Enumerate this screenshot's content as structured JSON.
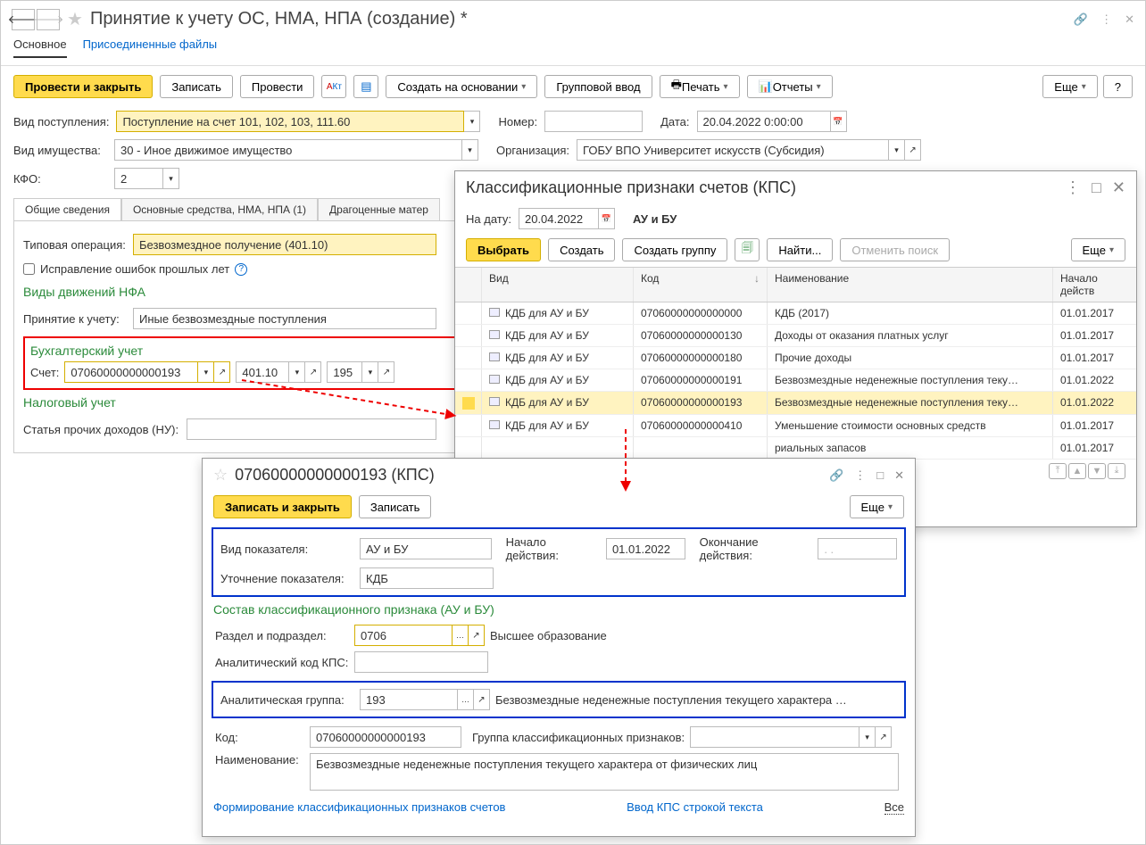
{
  "title": "Принятие к учету ОС, НМА, НПА (создание) *",
  "nav_tabs": {
    "main": "Основное",
    "attached": "Присоединенные файлы"
  },
  "toolbar": {
    "post_close": "Провести и закрыть",
    "save": "Записать",
    "post": "Провести",
    "create_based": "Создать на основании",
    "group_input": "Групповой ввод",
    "print": "Печать",
    "reports": "Отчеты",
    "more": "Еще",
    "help": "?"
  },
  "fields": {
    "type_receipt_label": "Вид поступления:",
    "type_receipt": "Поступление на счет 101, 102, 103, 111.60",
    "number_label": "Номер:",
    "date_label": "Дата:",
    "date": "20.04.2022  0:00:00",
    "property_label": "Вид имущества:",
    "property": "30 - Иное движимое имущество",
    "org_label": "Организация:",
    "org": "ГОБУ ВПО Университет искусств (Субсидия)",
    "kfo_label": "КФО:",
    "kfo": "2"
  },
  "inner_tabs": {
    "general": "Общие сведения",
    "os": "Основные средства, НМА, НПА (1)",
    "metals": "Драгоценные матер"
  },
  "general": {
    "typical_op_label": "Типовая операция:",
    "typical_op": "Безвозмездное получение (401.10)",
    "fix_errors": "Исправление ошибок прошлых лет",
    "section_moves": "Виды движений НФА",
    "acceptance_label": "Принятие к учету:",
    "acceptance": "Иные безвозмездные поступления",
    "section_acc": "Бухгалтерский учет",
    "account_label": "Счет:",
    "account_kps": "07060000000000193",
    "account_sub": "401.10",
    "account_kek": "195",
    "section_tax": "Налоговый учет",
    "tax_income_label": "Статья прочих доходов (НУ):"
  },
  "kps_popup": {
    "title": "Классификационные признаки счетов (КПС)",
    "date_label": "На дату:",
    "date": "20.04.2022",
    "mode": "АУ и БУ",
    "select": "Выбрать",
    "create": "Создать",
    "create_group": "Создать группу",
    "find": "Найти...",
    "cancel_search": "Отменить поиск",
    "more": "Еще",
    "col_type": "Вид",
    "col_code": "Код",
    "col_name": "Наименование",
    "col_start": "Начало действ",
    "rows": [
      {
        "type": "КДБ для АУ и БУ",
        "code": "07060000000000000",
        "name": "КДБ (2017)",
        "date": "01.01.2017"
      },
      {
        "type": "КДБ для АУ и БУ",
        "code": "07060000000000130",
        "name": "Доходы от оказания платных услуг",
        "date": "01.01.2017"
      },
      {
        "type": "КДБ для АУ и БУ",
        "code": "07060000000000180",
        "name": "Прочие доходы",
        "date": "01.01.2017"
      },
      {
        "type": "КДБ для АУ и БУ",
        "code": "07060000000000191",
        "name": "Безвозмездные неденежные поступления теку…",
        "date": "01.01.2022"
      },
      {
        "type": "КДБ для АУ и БУ",
        "code": "07060000000000193",
        "name": "Безвозмездные неденежные поступления теку…",
        "date": "01.01.2022"
      },
      {
        "type": "КДБ для АУ и БУ",
        "code": "07060000000000410",
        "name": "Уменьшение стоимости основных средств",
        "date": "01.01.2017"
      },
      {
        "type": "",
        "code": "",
        "name": "риальных запасов",
        "date": "01.01.2017"
      }
    ]
  },
  "detail_popup": {
    "title": "07060000000000193 (КПС)",
    "save_close": "Записать и закрыть",
    "save": "Записать",
    "more": "Еще",
    "indicator_type_label": "Вид показателя:",
    "indicator_type": "АУ и БУ",
    "start_label": "Начало действия:",
    "start": "01.01.2022",
    "end_label": "Окончание действия:",
    "end": ". .",
    "refine_label": "Уточнение показателя:",
    "refine": "КДБ",
    "section_composition": "Состав классификационного признака (АУ и БУ)",
    "section_subsection_label": "Раздел и подраздел:",
    "section_subsection": "0706",
    "section_subsection_name": "Высшее образование",
    "analytic_code_label": "Аналитический код КПС:",
    "analytic_group_label": "Аналитическая группа:",
    "analytic_group": "193",
    "analytic_group_name": "Безвозмездные неденежные поступления текущего характера …",
    "code_label": "Код:",
    "code": "07060000000000193",
    "group_label": "Группа классификационных признаков:",
    "name_label": "Наименование:",
    "name": "Безвозмездные неденежные поступления текущего характера от физических лиц",
    "link_form": "Формирование классификационных признаков счетов",
    "link_string": "Ввод КПС строкой текста",
    "all": "Все"
  }
}
